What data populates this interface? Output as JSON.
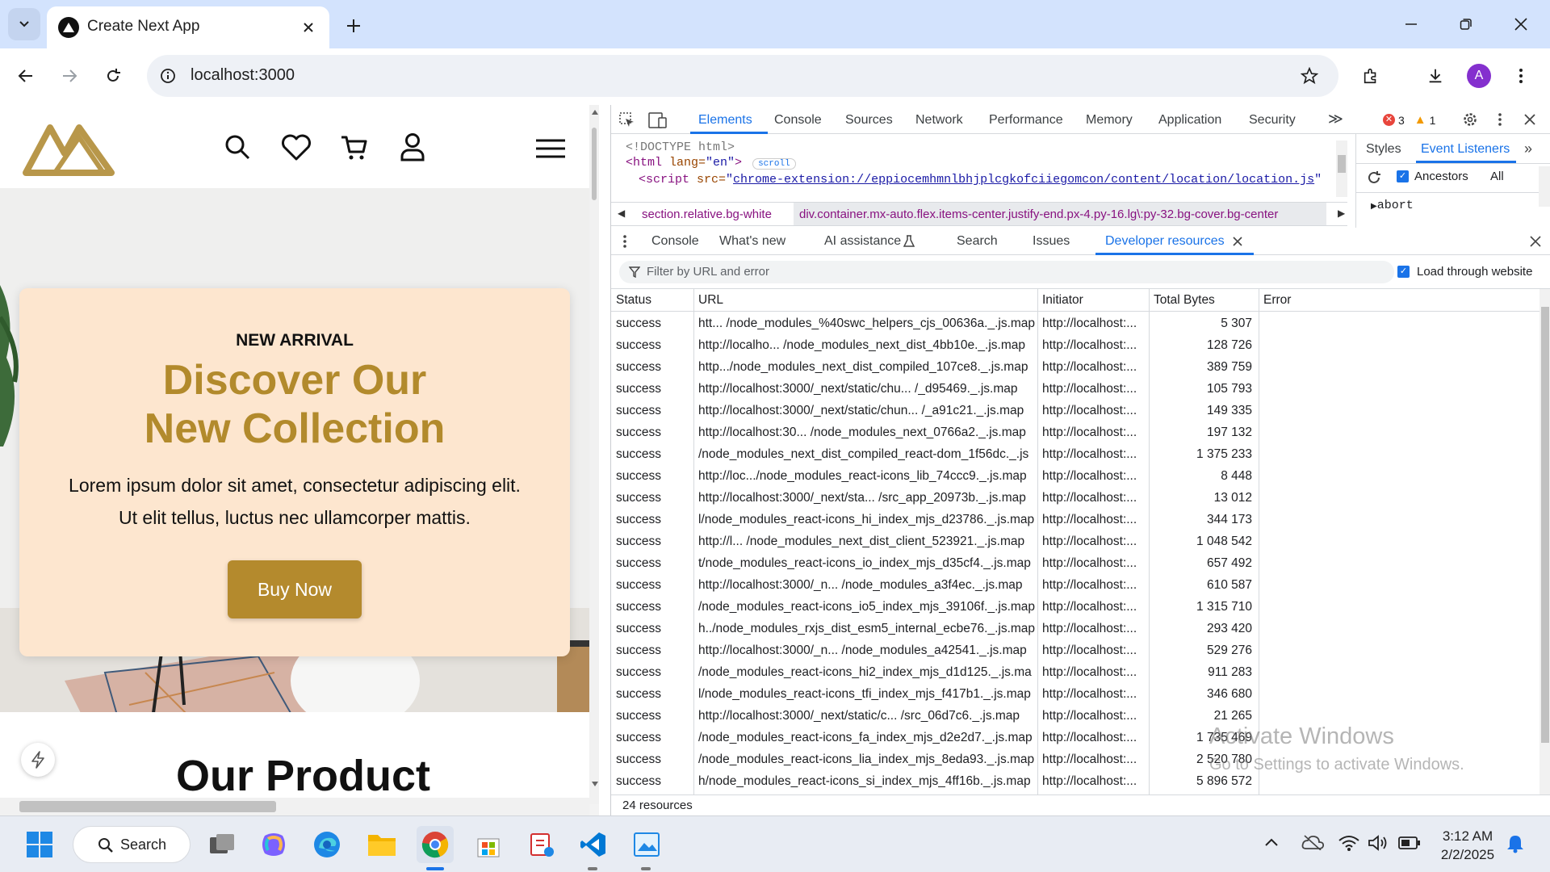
{
  "browser": {
    "tab_title": "Create Next App",
    "url": "localhost:3000",
    "profile_initial": "A"
  },
  "site": {
    "hero": {
      "eyebrow": "NEW ARRIVAL",
      "title_line1": "Discover Our",
      "title_line2": "New Collection",
      "desc_line1": "Lorem ipsum dolor sit amet, consectetur adipiscing elit.",
      "desc_line2": "Ut elit tellus, luctus nec ullamcorper mattis.",
      "cta": "Buy Now"
    },
    "product_heading": "Our Product"
  },
  "devtools": {
    "tabs": [
      "Elements",
      "Console",
      "Sources",
      "Network",
      "Performance",
      "Memory",
      "Application",
      "Security"
    ],
    "more_tabs": "≫",
    "error_count": "3",
    "warning_count": "1",
    "side_tabs": [
      "Styles",
      "Event Listeners"
    ],
    "ancestors_label": "Ancestors",
    "all_label": "All",
    "listener": "abort",
    "dom": {
      "doctype": "<!DOCTYPE html>",
      "html_open_tag": "<html",
      "html_attr_name": " lang=",
      "html_attr_value": "\"en\"",
      "html_close_bracket": ">",
      "scroll_badge": "scroll",
      "script_open": "<script",
      "script_attr": " src=",
      "script_src": "chrome-extension://eppiocemhmnlbhjplcgkofciiegomcon/content/location/location.js",
      "script_quote": "\""
    },
    "breadcrumbs": [
      "section.relative.bg-white",
      "div.container.mx-auto.flex.items-center.justify-end.px-4.py-16.lg\\:py-32.bg-cover.bg-center"
    ],
    "drawer_tabs": [
      "Console",
      "What's new",
      "AI assistance",
      "Search",
      "Issues",
      "Developer resources"
    ],
    "filter_placeholder": "Filter by URL and error",
    "load_through_website": "Load through website",
    "columns": [
      "Status",
      "URL",
      "Initiator",
      "Total Bytes",
      "Error"
    ],
    "rows": [
      {
        "status": "success",
        "url": "htt... /node_modules_%40swc_helpers_cjs_00636a._.js.map",
        "initiator": "http://localhost:...",
        "bytes": "5 307"
      },
      {
        "status": "success",
        "url": "http://localho... /node_modules_next_dist_4bb10e._.js.map",
        "initiator": "http://localhost:...",
        "bytes": "128 726"
      },
      {
        "status": "success",
        "url": "http.../node_modules_next_dist_compiled_107ce8._.js.map",
        "initiator": "http://localhost:...",
        "bytes": "389 759"
      },
      {
        "status": "success",
        "url": "http://localhost:3000/_next/static/chu... /_d95469._.js.map",
        "initiator": "http://localhost:...",
        "bytes": "105 793"
      },
      {
        "status": "success",
        "url": "http://localhost:3000/_next/static/chun... /_a91c21._.js.map",
        "initiator": "http://localhost:...",
        "bytes": "149 335"
      },
      {
        "status": "success",
        "url": "http://localhost:30... /node_modules_next_0766a2._.js.map",
        "initiator": "http://localhost:...",
        "bytes": "197 132"
      },
      {
        "status": "success",
        "url": "/node_modules_next_dist_compiled_react-dom_1f56dc._.js",
        "initiator": "http://localhost:...",
        "bytes": "1 375 233"
      },
      {
        "status": "success",
        "url": "http://loc.../node_modules_react-icons_lib_74ccc9._.js.map",
        "initiator": "http://localhost:...",
        "bytes": "8 448"
      },
      {
        "status": "success",
        "url": "http://localhost:3000/_next/sta... /src_app_20973b._.js.map",
        "initiator": "http://localhost:...",
        "bytes": "13 012"
      },
      {
        "status": "success",
        "url": "l/node_modules_react-icons_hi_index_mjs_d23786._.js.map",
        "initiator": "http://localhost:...",
        "bytes": "344 173"
      },
      {
        "status": "success",
        "url": "http://l... /node_modules_next_dist_client_523921._.js.map",
        "initiator": "http://localhost:...",
        "bytes": "1 048 542"
      },
      {
        "status": "success",
        "url": "t/node_modules_react-icons_io_index_mjs_d35cf4._.js.map",
        "initiator": "http://localhost:...",
        "bytes": "657 492"
      },
      {
        "status": "success",
        "url": "http://localhost:3000/_n... /node_modules_a3f4ec._.js.map",
        "initiator": "http://localhost:...",
        "bytes": "610 587"
      },
      {
        "status": "success",
        "url": "/node_modules_react-icons_io5_index_mjs_39106f._.js.map",
        "initiator": "http://localhost:...",
        "bytes": "1 315 710"
      },
      {
        "status": "success",
        "url": "h../node_modules_rxjs_dist_esm5_internal_ecbe76._.js.map",
        "initiator": "http://localhost:...",
        "bytes": "293 420"
      },
      {
        "status": "success",
        "url": "http://localhost:3000/_n... /node_modules_a42541._.js.map",
        "initiator": "http://localhost:...",
        "bytes": "529 276"
      },
      {
        "status": "success",
        "url": "/node_modules_react-icons_hi2_index_mjs_d1d125._.js.ma",
        "initiator": "http://localhost:...",
        "bytes": "911 283"
      },
      {
        "status": "success",
        "url": "l/node_modules_react-icons_tfi_index_mjs_f417b1._.js.map",
        "initiator": "http://localhost:...",
        "bytes": "346 680"
      },
      {
        "status": "success",
        "url": "http://localhost:3000/_next/static/c... /src_06d7c6._.js.map",
        "initiator": "http://localhost:...",
        "bytes": "21 265"
      },
      {
        "status": "success",
        "url": "/node_modules_react-icons_fa_index_mjs_d2e2d7._.js.map",
        "initiator": "http://localhost:...",
        "bytes": "1 735 469"
      },
      {
        "status": "success",
        "url": "/node_modules_react-icons_lia_index_mjs_8eda93._.js.map",
        "initiator": "http://localhost:...",
        "bytes": "2 520 780"
      },
      {
        "status": "success",
        "url": "h/node_modules_react-icons_si_index_mjs_4ff16b._.js.map",
        "initiator": "http://localhost:...",
        "bytes": "5 896 572"
      }
    ],
    "resource_count": "24 resources"
  },
  "watermark": {
    "line1": "Activate Windows",
    "line2": "Go to Settings to activate Windows."
  },
  "taskbar": {
    "search_label": "Search",
    "time": "3:12 AM",
    "date": "2/2/2025"
  },
  "colors": {
    "brand_gold": "#b28a2c",
    "card_bg": "#fde6cf",
    "devtools_accent": "#1a73e8"
  }
}
